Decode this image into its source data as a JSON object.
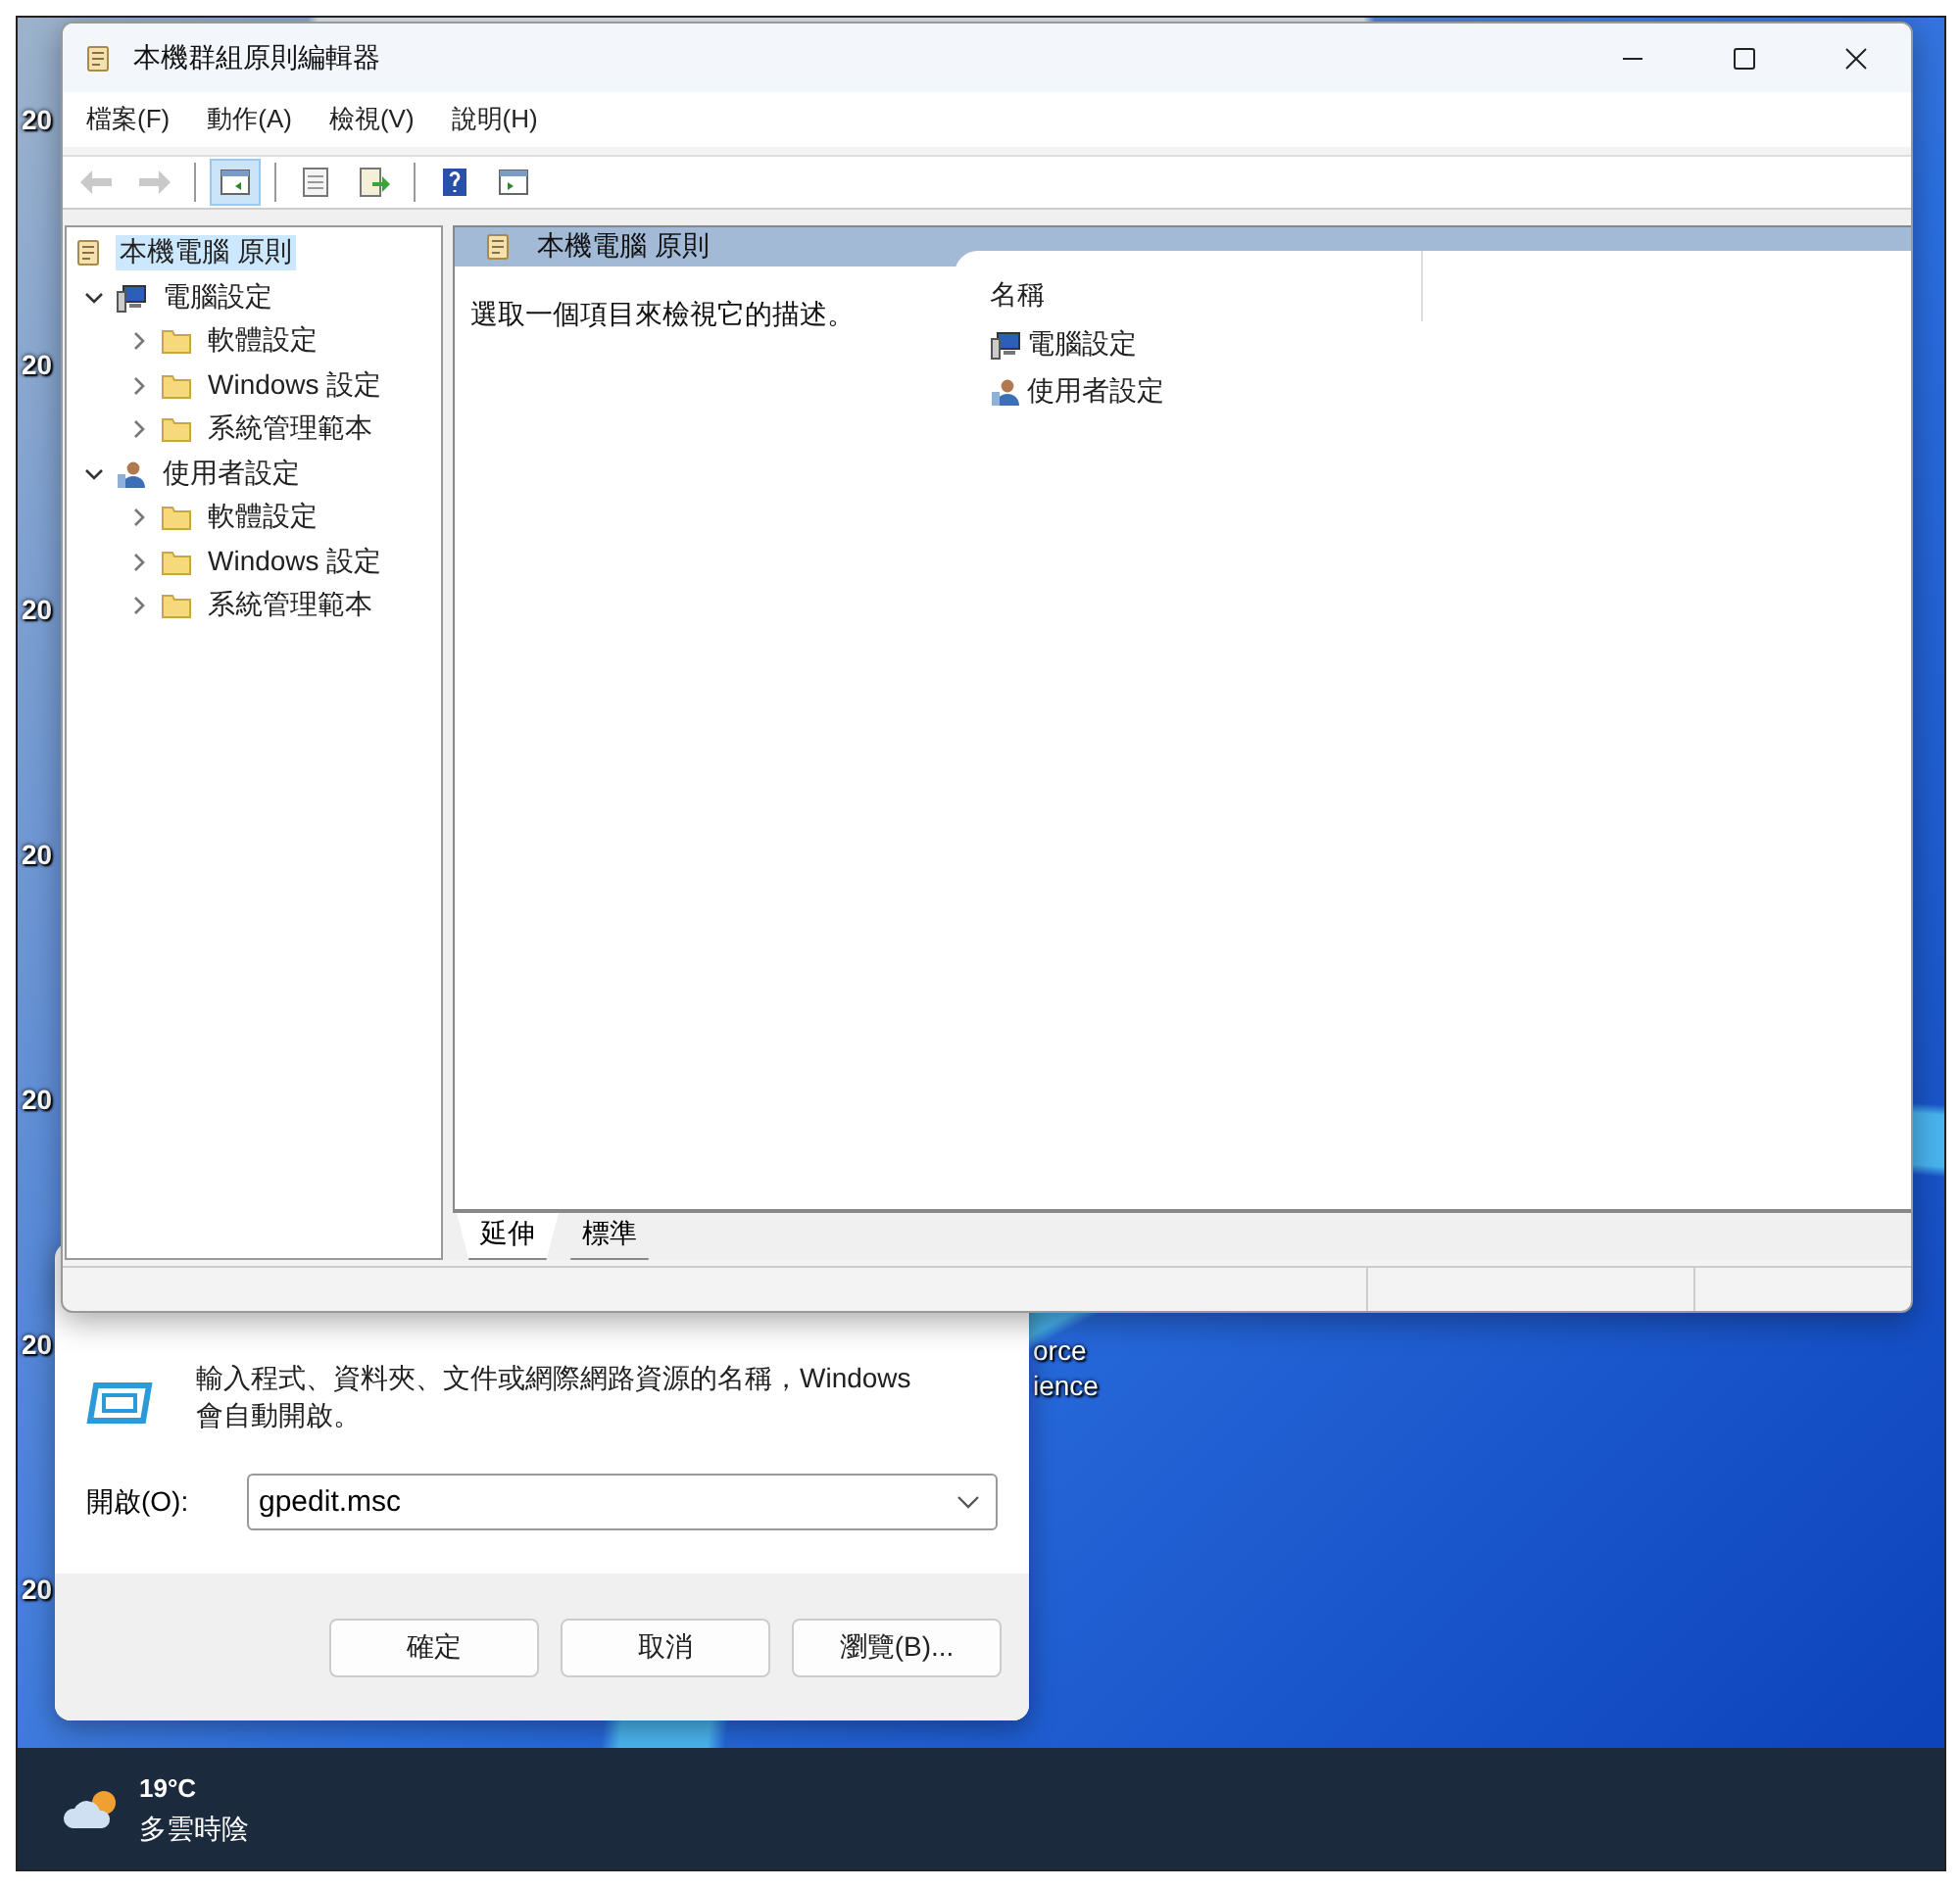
{
  "window": {
    "title": "本機群組原則編輯器"
  },
  "menu": [
    "檔案(F)",
    "動作(A)",
    "檢視(V)",
    "說明(H)"
  ],
  "toolbar": [
    {
      "kind": "back",
      "disabled": true,
      "selected": false
    },
    {
      "kind": "forward",
      "disabled": true,
      "selected": false
    },
    {
      "kind": "separator"
    },
    {
      "kind": "tree-toggle",
      "disabled": false,
      "selected": true
    },
    {
      "kind": "separator"
    },
    {
      "kind": "properties",
      "disabled": false,
      "selected": false
    },
    {
      "kind": "export",
      "disabled": false,
      "selected": false
    },
    {
      "kind": "separator"
    },
    {
      "kind": "help",
      "disabled": false,
      "selected": false
    },
    {
      "kind": "pane",
      "disabled": false,
      "selected": false
    }
  ],
  "tree": [
    {
      "label": "本機電腦 原則",
      "kind": "policy",
      "selected": true,
      "children": [
        {
          "label": "電腦設定",
          "kind": "computer",
          "expanded": true,
          "selected": false,
          "children": [
            {
              "label": "軟體設定",
              "kind": "folder",
              "expanded": false,
              "selected": false
            },
            {
              "label": "Windows 設定",
              "kind": "folder",
              "expanded": false,
              "selected": false
            },
            {
              "label": "系統管理範本",
              "kind": "folder",
              "expanded": false,
              "selected": false
            }
          ]
        },
        {
          "label": "使用者設定",
          "kind": "user",
          "expanded": true,
          "selected": false,
          "children": [
            {
              "label": "軟體設定",
              "kind": "folder",
              "expanded": false,
              "selected": false
            },
            {
              "label": "Windows 設定",
              "kind": "folder",
              "expanded": false,
              "selected": false
            },
            {
              "label": "系統管理範本",
              "kind": "folder",
              "expanded": false,
              "selected": false
            }
          ]
        }
      ]
    }
  ],
  "details": {
    "header": "本機電腦 原則",
    "description": "選取一個項目來檢視它的描述。",
    "column": "名稱",
    "items": [
      {
        "label": "電腦設定",
        "kind": "computer"
      },
      {
        "label": "使用者設定",
        "kind": "user"
      }
    ]
  },
  "view_tabs": [
    {
      "label": "延伸",
      "selected": true
    },
    {
      "label": "標準",
      "selected": false
    }
  ],
  "run_dialog": {
    "message": "輸入程式、資料夾、文件或網際網路資源的名稱，Windows 會自動開啟。",
    "open_label": "開啟(O):",
    "value": "gpedit.msc",
    "buttons": [
      "確定",
      "取消",
      "瀏覽(B)..."
    ]
  },
  "desktop_labels": [
    "20",
    "20",
    "20",
    "20",
    "20",
    "20",
    "20"
  ],
  "desktop_text": [
    "orce",
    "ience"
  ],
  "taskbar": {
    "temperature": "19°C",
    "weather": "多雲時陰"
  }
}
